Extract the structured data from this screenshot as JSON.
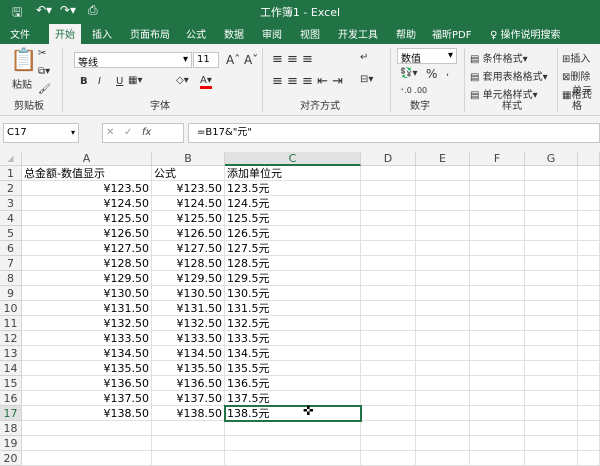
{
  "window": {
    "title": "工作簿1 - Excel"
  },
  "tabs": [
    "文件",
    "开始",
    "插入",
    "页面布局",
    "公式",
    "数据",
    "审阅",
    "视图",
    "开发工具",
    "帮助",
    "福昕PDF"
  ],
  "tell_me": "操作说明搜索",
  "ribbon": {
    "paste": "粘贴",
    "clipboard": "剪贴板",
    "font_name": "等线",
    "font_size": "11",
    "font": "字体",
    "alignment": "对齐方式",
    "number_format": "数值",
    "number": "数字",
    "cond_format": "条件格式",
    "table_format": "套用表格格式",
    "cell_style": "单元格样式",
    "styles": "样式",
    "insert": "插入",
    "delete": "删除",
    "format": "格式",
    "cells": "单元格",
    "bold": "B",
    "italic": "I",
    "underline": "U",
    "percent": "%",
    "comma": ","
  },
  "formula_bar": {
    "name_box": "C17",
    "formula": "=B17&\"元\"",
    "fx": "fx"
  },
  "columns": [
    "A",
    "B",
    "C",
    "D",
    "E",
    "F",
    "G"
  ],
  "headers": [
    "总金额-数值显示",
    "公式",
    "添加单位元"
  ],
  "rows": [
    [
      "¥123.50",
      "¥123.50",
      "123.5元"
    ],
    [
      "¥124.50",
      "¥124.50",
      "124.5元"
    ],
    [
      "¥125.50",
      "¥125.50",
      "125.5元"
    ],
    [
      "¥126.50",
      "¥126.50",
      "126.5元"
    ],
    [
      "¥127.50",
      "¥127.50",
      "127.5元"
    ],
    [
      "¥128.50",
      "¥128.50",
      "128.5元"
    ],
    [
      "¥129.50",
      "¥129.50",
      "129.5元"
    ],
    [
      "¥130.50",
      "¥130.50",
      "130.5元"
    ],
    [
      "¥131.50",
      "¥131.50",
      "131.5元"
    ],
    [
      "¥132.50",
      "¥132.50",
      "132.5元"
    ],
    [
      "¥133.50",
      "¥133.50",
      "133.5元"
    ],
    [
      "¥134.50",
      "¥134.50",
      "134.5元"
    ],
    [
      "¥135.50",
      "¥135.50",
      "135.5元"
    ],
    [
      "¥136.50",
      "¥136.50",
      "136.5元"
    ],
    [
      "¥137.50",
      "¥137.50",
      "137.5元"
    ],
    [
      "¥138.50",
      "¥138.50",
      "138.5元"
    ]
  ],
  "row_numbers": [
    "1",
    "2",
    "3",
    "4",
    "5",
    "6",
    "7",
    "8",
    "9",
    "10",
    "11",
    "12",
    "13",
    "14",
    "15",
    "16",
    "17",
    "18",
    "19",
    "20"
  ]
}
